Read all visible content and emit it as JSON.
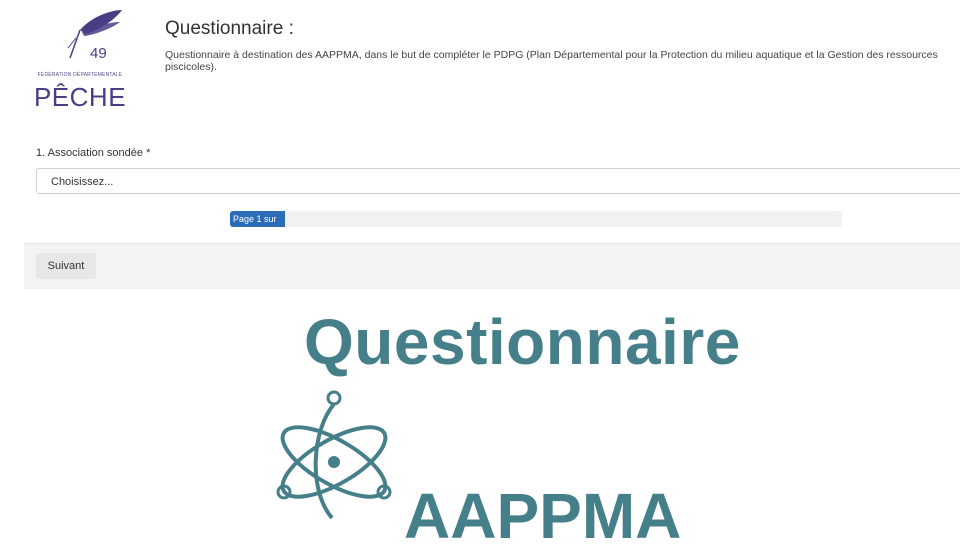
{
  "logo": {
    "number": "49",
    "federation": "FÉDÉRATION DÉPARTEMENTALE",
    "name": "PÊCHE",
    "color": "#4b3c86"
  },
  "questionnaire": {
    "title": "Questionnaire :",
    "description": "Questionnaire à destination des AAPPMA, dans le but de compléter le PDPG (Plan Départemental pour la Protection du milieu aquatique et la Gestion des ressources piscicoles)."
  },
  "form": {
    "question_label": "1. Association sondée *",
    "select_value": "Choisissez..."
  },
  "progress": {
    "text": "Page 1 sur",
    "fraction": 0.09,
    "color": "#2b6cb8"
  },
  "footer": {
    "next_label": "Suivant"
  },
  "overlay": {
    "title": "Questionnaire",
    "subtitle": "AAPPMA",
    "icon": "atom-icon",
    "color": "#45808a"
  }
}
